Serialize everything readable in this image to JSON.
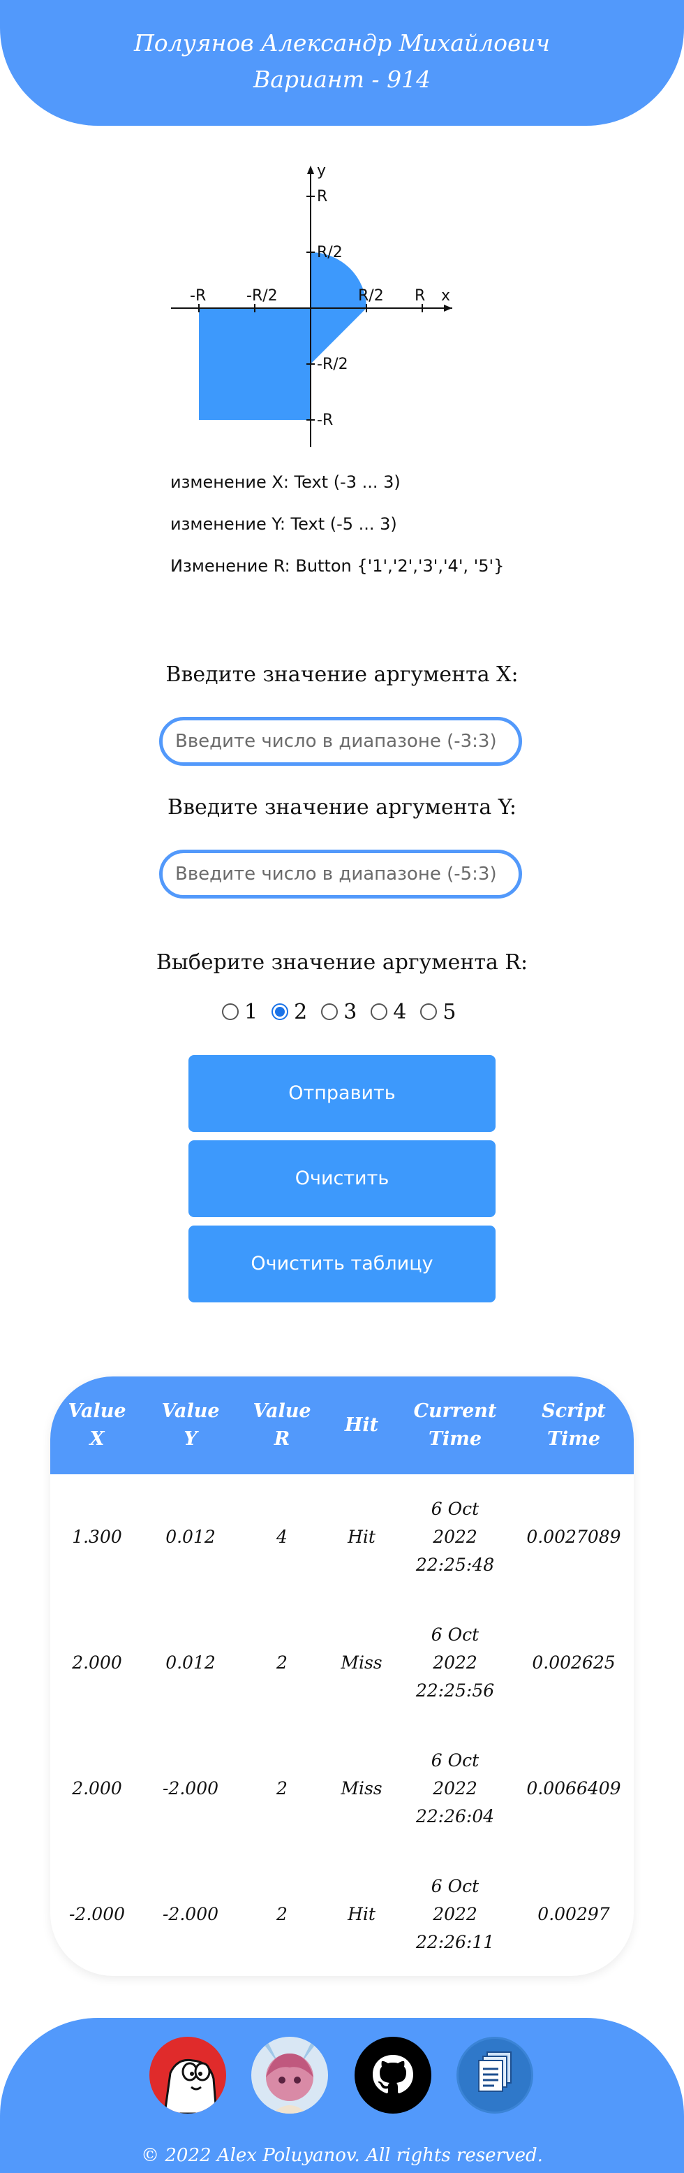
{
  "header": {
    "name": "Полуянов Александр Михайлович",
    "variant": "Вариант - 914"
  },
  "graph": {
    "axis_x": "x",
    "axis_y": "y",
    "labels_x": [
      "-R",
      "-R/2",
      "R/2",
      "R"
    ],
    "labels_y": [
      "R",
      "R/2",
      "-R/2",
      "-R"
    ]
  },
  "info": {
    "line1": "изменение X: Text (-3 ... 3)",
    "line2": "изменение Y: Text (-5 ... 3)",
    "line3": "Изменение R: Button {'1','2','3','4', '5'}"
  },
  "form": {
    "x_label": "Введите значение аргумента X:",
    "x_placeholder": "Введите число в диапазоне (-3:3)",
    "y_label": "Введите значение аргумента Y:",
    "y_placeholder": "Введите число в диапазоне (-5:3)",
    "r_label": "Выберите значение аргумента R:",
    "r_options": [
      "1",
      "2",
      "3",
      "4",
      "5"
    ],
    "r_selected": "2",
    "submit": "Отправить",
    "clear": "Очистить",
    "clear_table": "Очистить таблицу"
  },
  "table": {
    "headers": [
      [
        "Value",
        "X"
      ],
      [
        "Value",
        "Y"
      ],
      [
        "Value",
        "R"
      ],
      [
        "Hit",
        ""
      ],
      [
        "Current",
        "Time"
      ],
      [
        "Script",
        "Time"
      ]
    ],
    "rows": [
      {
        "x": "1.300",
        "y": "0.012",
        "r": "4",
        "hit": "Hit",
        "date": "6 Oct",
        "year": "2022",
        "time": "22:25:48",
        "script": "0.0027089"
      },
      {
        "x": "2.000",
        "y": "0.012",
        "r": "2",
        "hit": "Miss",
        "date": "6 Oct",
        "year": "2022",
        "time": "22:25:56",
        "script": "0.002625"
      },
      {
        "x": "2.000",
        "y": "-2.000",
        "r": "2",
        "hit": "Miss",
        "date": "6 Oct",
        "year": "2022",
        "time": "22:26:04",
        "script": "0.0066409"
      },
      {
        "x": "-2.000",
        "y": "-2.000",
        "r": "2",
        "hit": "Hit",
        "date": "6 Oct",
        "year": "2022",
        "time": "22:26:11",
        "script": "0.00297"
      }
    ]
  },
  "footer": {
    "links": [
      "cat-avatar-icon",
      "anime-avatar-icon",
      "github-icon",
      "docs-icon"
    ],
    "copyright": "© 2022 Alex Poluyanov. All rights reserved."
  },
  "colors": {
    "accent": "#5299fb",
    "button": "#3d99fc",
    "area": "#3d99fc"
  }
}
